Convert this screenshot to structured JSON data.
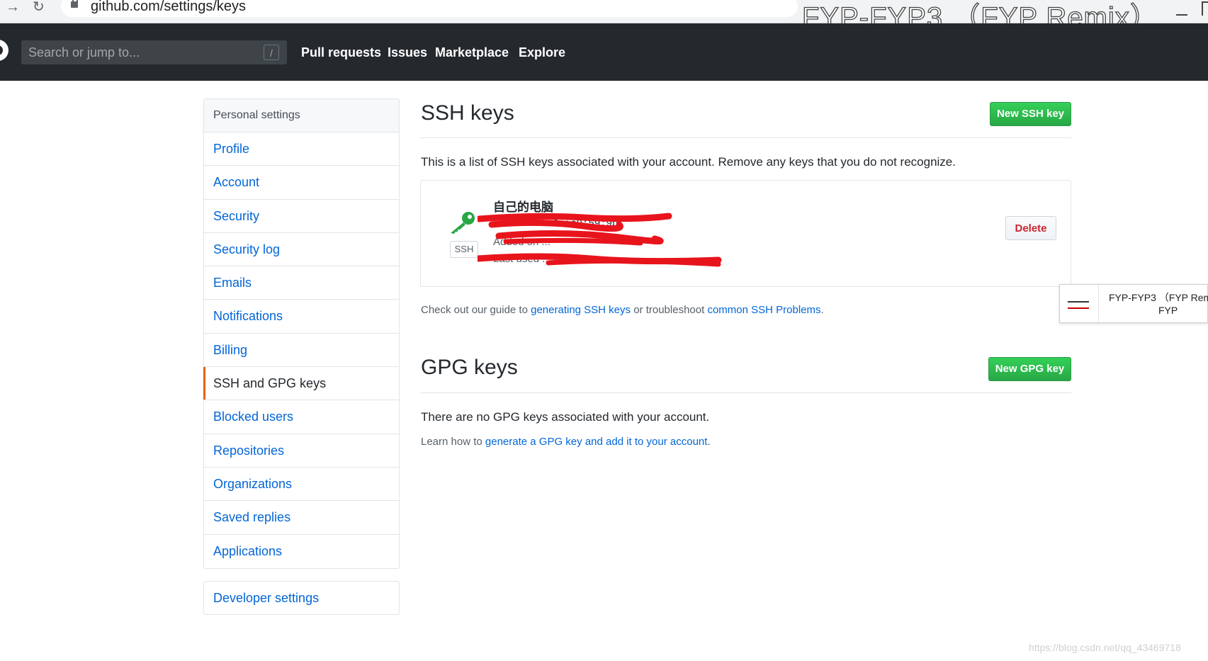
{
  "browser": {
    "url": "github.com/settings/keys",
    "window_title": "FYP-FYP3 （FYP Remix）"
  },
  "header": {
    "search_placeholder": "Search or jump to...",
    "search_shortcut": "/",
    "nav": [
      "Pull requests",
      "Issues",
      "Marketplace",
      "Explore"
    ]
  },
  "sidebar": {
    "heading": "Personal settings",
    "items": [
      "Profile",
      "Account",
      "Security",
      "Security log",
      "Emails",
      "Notifications",
      "Billing",
      "SSH and GPG keys",
      "Blocked users",
      "Repositories",
      "Organizations",
      "Saved replies",
      "Applications"
    ],
    "selected": "SSH and GPG keys",
    "developer": "Developer settings"
  },
  "ssh": {
    "title": "SSH keys",
    "new_button": "New SSH key",
    "description": "This is a list of SSH keys associated with your account. Remove any keys that you do not recognize.",
    "key": {
      "title": "自己的电脑",
      "fingerprint": "...:f7:2b:6e:c9:59:9b",
      "added": "Added on ...",
      "last_used": "Last used ... /write",
      "badge": "SSH",
      "delete_button": "Delete"
    },
    "guide": {
      "prefix": "Check out our guide to ",
      "link1": "generating SSH keys",
      "middle": " or troubleshoot ",
      "link2": "common SSH Problems",
      "suffix": "."
    }
  },
  "gpg": {
    "title": "GPG keys",
    "new_button": "New GPG key",
    "empty": "There are no GPG keys associated with your account.",
    "learn": {
      "prefix": "Learn how to ",
      "link": "generate a GPG key and add it to your account",
      "suffix": "."
    }
  },
  "toast": {
    "line1": "FYP-FYP3 （FYP Rem",
    "line2": "FYP"
  },
  "watermark": "https://blog.csdn.net/qq_43469718",
  "colors": {
    "header_bg": "#24292e",
    "link": "#0366d6",
    "green_button": "#28a745",
    "danger": "#cb2431",
    "selected_accent": "#e36209",
    "redaction": "#e8141c"
  }
}
